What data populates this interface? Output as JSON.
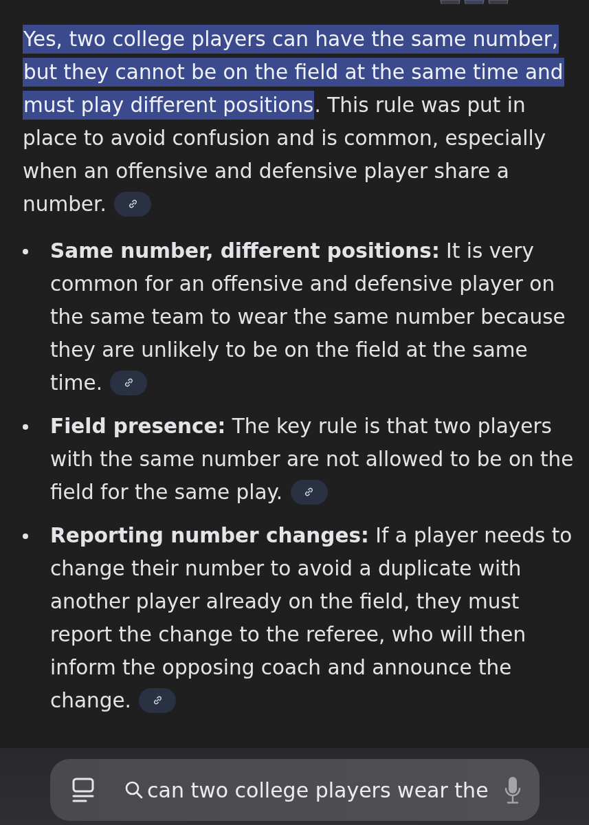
{
  "answer": {
    "intro": {
      "highlighted": "Yes, two college players can have the same number, but they cannot be on the field at the same time and must play different positions",
      "text": ". This rule was put in place to avoid confusion and is common, especially when an offensive and defensive player share a number."
    },
    "bullets": [
      {
        "text": "**Same number, different positions:** It is very common for an offensive and defensive player on the same team to wear the same number because they are unlikely to be on the field at the same time."
      },
      {
        "text": "**Field presence:** The key rule is that two players with the same number are not allowed to be on the field for the same play."
      },
      {
        "text": "**Reporting number changes:** If a player needs to change their number to avoid a duplicate with another player already on the field, they must report the change to the referee, who will then inform the opposing coach and announce the change."
      }
    ]
  },
  "search_bar": {
    "value": "can two college players wear the"
  }
}
